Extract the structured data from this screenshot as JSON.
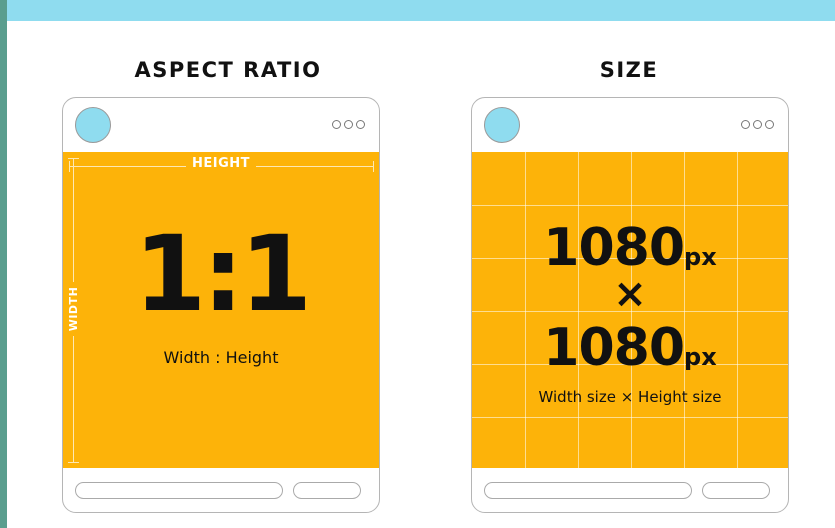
{
  "panels": {
    "aspect": {
      "title": "ASPECT RATIO",
      "height_label": "HEIGHT",
      "width_label": "WIDTH",
      "ratio": "1:1",
      "caption": "Width : Height"
    },
    "size": {
      "title": "SIZE",
      "width_value": "1080",
      "height_value": "1080",
      "unit": "px",
      "times": "×",
      "caption": "Width size × Height size"
    }
  },
  "colors": {
    "accent_blue": "#8fdcef",
    "canvas_orange": "#fdb309",
    "background_teal": "#5a9e8e"
  },
  "icons": [
    "avatar-circle",
    "more-dots-icon"
  ]
}
